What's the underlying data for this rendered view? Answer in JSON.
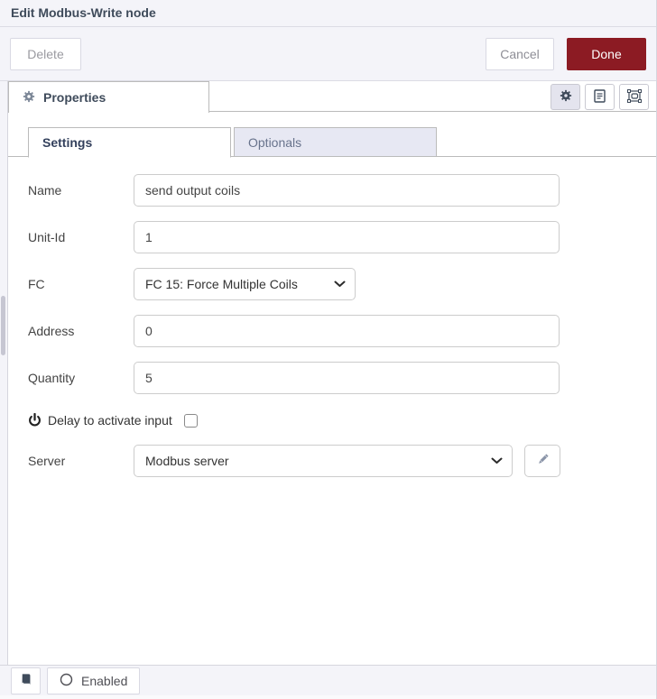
{
  "dialog": {
    "title": "Edit Modbus-Write node",
    "delete_label": "Delete",
    "cancel_label": "Cancel",
    "done_label": "Done",
    "properties_tab": "Properties",
    "toolbar_icons": [
      "gear-icon",
      "document-icon",
      "appearance-icon"
    ]
  },
  "form": {
    "subtabs": {
      "settings": "Settings",
      "optionals": "Optionals"
    },
    "name": {
      "label": "Name",
      "value": "send output coils"
    },
    "unit_id": {
      "label": "Unit-Id",
      "value": "1"
    },
    "fc": {
      "label": "FC",
      "value": "FC 15: Force Multiple Coils"
    },
    "address": {
      "label": "Address",
      "value": "0"
    },
    "quantity": {
      "label": "Quantity",
      "value": "5"
    },
    "delay": {
      "label": "Delay to activate input",
      "checked": false
    },
    "server": {
      "label": "Server",
      "value": "Modbus server"
    }
  },
  "footer": {
    "enabled_label": "Enabled"
  },
  "colors": {
    "done_red": "#8c1b23",
    "panel_bg": "#f4f4f9",
    "inactive_tab_bg": "#e7e8f3",
    "icon_slate": "#3f4b5b"
  }
}
